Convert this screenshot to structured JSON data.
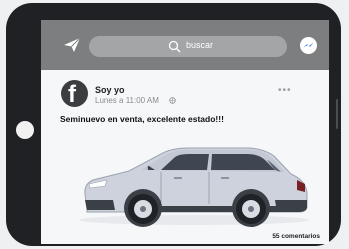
{
  "header": {
    "search_placeholder": "buscar",
    "left_icon": "send-icon",
    "right_icon": "messenger-icon"
  },
  "post": {
    "author": "Soy yo",
    "time": "Lunes a 11:00 AM",
    "privacy_icon": "globe-icon",
    "more_label": "•••",
    "text": "Seminuevo en venta, excelente estado!!!",
    "image_icon": "car-image",
    "comments": "55 comentarios"
  },
  "colors": {
    "topbar": "#7d7e80",
    "search_bg": "#a4a5a7",
    "tablet": "#1f2124",
    "car_body": "#cdd2dc",
    "messenger_accent": "#4a8de0"
  }
}
